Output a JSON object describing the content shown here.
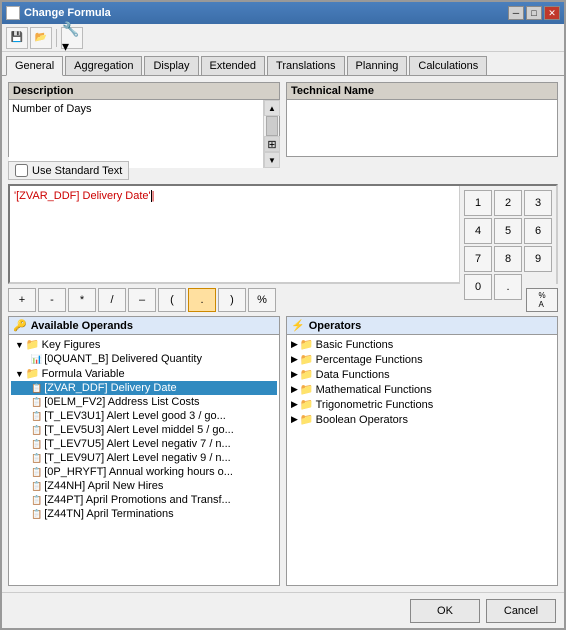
{
  "window": {
    "title": "Change Formula",
    "icon": "formula-icon"
  },
  "toolbar": {
    "buttons": [
      "save",
      "open",
      "settings"
    ]
  },
  "tabs": {
    "items": [
      {
        "label": "General",
        "active": true
      },
      {
        "label": "Aggregation",
        "active": false
      },
      {
        "label": "Display",
        "active": false
      },
      {
        "label": "Extended",
        "active": false
      },
      {
        "label": "Translations",
        "active": false
      },
      {
        "label": "Planning",
        "active": false
      },
      {
        "label": "Calculations",
        "active": false
      }
    ]
  },
  "description": {
    "header": "Description",
    "value": "Number of Days"
  },
  "technical_name": {
    "header": "Technical Name",
    "value": ""
  },
  "checkbox": {
    "label": "Use Standard Text"
  },
  "formula": {
    "value": "'[ZVAR_DDF] Delivery Date'"
  },
  "numpad": {
    "buttons": [
      "1",
      "2",
      "3",
      "4",
      "5",
      "6",
      "7",
      "8",
      "9",
      "0",
      "."
    ]
  },
  "operators": {
    "buttons": [
      "+",
      "-",
      "*",
      "/",
      "–",
      "(",
      ".",
      ")",
      "%"
    ],
    "special": "% A"
  },
  "operands": {
    "title": "Available Operands",
    "tree": [
      {
        "indent": 0,
        "label": "Key Figures",
        "type": "folder",
        "expand": true
      },
      {
        "indent": 1,
        "label": "[0QUANT_B] Delivered Quantity",
        "type": "item"
      },
      {
        "indent": 0,
        "label": "Formula Variable",
        "type": "folder",
        "expand": true
      },
      {
        "indent": 1,
        "label": "[ZVAR_DDF] Delivery Date",
        "type": "item",
        "selected": true
      },
      {
        "indent": 1,
        "label": "[0ELM_FV2] Address List Costs",
        "type": "item"
      },
      {
        "indent": 1,
        "label": "[T_LEV3U1] Alert Level good 3 / go...",
        "type": "item"
      },
      {
        "indent": 1,
        "label": "[T_LEV5U3] Alert Level middel 5 / go...",
        "type": "item"
      },
      {
        "indent": 1,
        "label": "[T_LEV7U5] Alert Level negativ 7 / n...",
        "type": "item"
      },
      {
        "indent": 1,
        "label": "[T_LEV9U7] Alert Level negativ 9 / n...",
        "type": "item"
      },
      {
        "indent": 1,
        "label": "[0P_HRYFT] Annual working hours o...",
        "type": "item"
      },
      {
        "indent": 1,
        "label": "[Z44NH] April New Hires",
        "type": "item"
      },
      {
        "indent": 1,
        "label": "[Z44PT] April Promotions and Transf...",
        "type": "item"
      },
      {
        "indent": 1,
        "label": "[Z44TN] April Terminations",
        "type": "item"
      }
    ]
  },
  "operators_panel": {
    "title": "Operators",
    "tree": [
      {
        "indent": 0,
        "label": "Basic Functions",
        "type": "folder"
      },
      {
        "indent": 0,
        "label": "Percentage Functions",
        "type": "folder"
      },
      {
        "indent": 0,
        "label": "Data Functions",
        "type": "folder"
      },
      {
        "indent": 0,
        "label": "Mathematical Functions",
        "type": "folder"
      },
      {
        "indent": 0,
        "label": "Trigonometric Functions",
        "type": "folder"
      },
      {
        "indent": 0,
        "label": "Boolean Operators",
        "type": "folder"
      }
    ]
  },
  "footer": {
    "ok_label": "OK",
    "cancel_label": "Cancel"
  }
}
